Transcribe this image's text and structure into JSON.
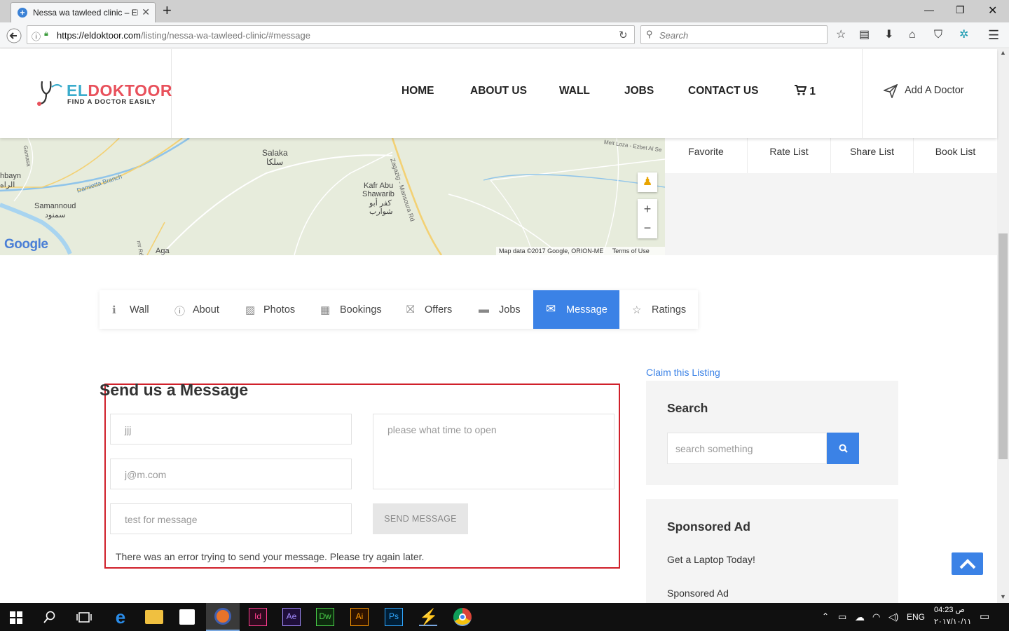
{
  "browser": {
    "tab_title": "Nessa wa tawleed clinic – El",
    "url_host": "https://eldoktoor.com",
    "url_path": "/listing/nessa-wa-tawleed-clinic/#message",
    "search_placeholder": "Search"
  },
  "site": {
    "logo_part1": "EL",
    "logo_part2": "DOKTOOR",
    "logo_tagline": "FIND A DOCTOR EASILY",
    "menu": [
      "HOME",
      "ABOUT US",
      "WALL",
      "JOBS",
      "CONTACT US"
    ],
    "cart_count": "1",
    "add_doctor": "Add A Doctor"
  },
  "map": {
    "labels": {
      "salaka": "Salaka",
      "salaka_ar": "سلكا",
      "kafr": "Kafr Abu",
      "shawarib": "Shawarib",
      "kafr_ar1": "كفر أبو",
      "kafr_ar2": "شوارب",
      "samannoud": "Samannoud",
      "samannoud_ar": "سمنود",
      "hbayn": "hbayn",
      "hbayn_ar": "الراه",
      "damietta": "Damietta Branch",
      "road": "Zagazig - Mansoura Rd",
      "gamasa": "Gamasa",
      "aga": "Aga",
      "meit": "Meit Loza - Ezbet Al Se",
      "mr": "mr Rd"
    },
    "google": "Google",
    "attribution": "Map data ©2017 Google, ORION-ME",
    "terms": "Terms of Use"
  },
  "actions": [
    "Favorite",
    "Rate List",
    "Share List",
    "Book List"
  ],
  "listing_tabs": [
    {
      "icon": "info-icon",
      "label": "Wall"
    },
    {
      "icon": "question-icon",
      "label": "About"
    },
    {
      "icon": "photo-icon",
      "label": "Photos"
    },
    {
      "icon": "calendar-icon",
      "label": "Bookings"
    },
    {
      "icon": "gift-icon",
      "label": "Offers"
    },
    {
      "icon": "briefcase-icon",
      "label": "Jobs"
    },
    {
      "icon": "envelope-icon",
      "label": "Message"
    },
    {
      "icon": "star-icon",
      "label": "Ratings"
    }
  ],
  "active_tab": "Message",
  "message_form": {
    "title": "Send us a Message",
    "name_value": "jjj",
    "email_value": "j@m.com",
    "subject_value": "test for message",
    "message_value": "please what time to open",
    "send_label": "SEND MESSAGE",
    "error": "There was an error trying to send your message. Please try again later."
  },
  "sidebar": {
    "claim": "Claim this Listing",
    "search_title": "Search",
    "search_placeholder": "search something",
    "sponsored_title": "Sponsored Ad",
    "sponsored_item1": "Get a Laptop Today!",
    "sponsored_item2": "Sponsored Ad"
  },
  "taskbar": {
    "lang": "ENG",
    "time": "04:23 ص",
    "date": "٢٠١٧/١٠/١١"
  },
  "colors": {
    "accent": "#3b82e6",
    "logo_blue": "#3aaccc",
    "logo_red": "#e8505b",
    "highlight_box": "#d0202a"
  }
}
